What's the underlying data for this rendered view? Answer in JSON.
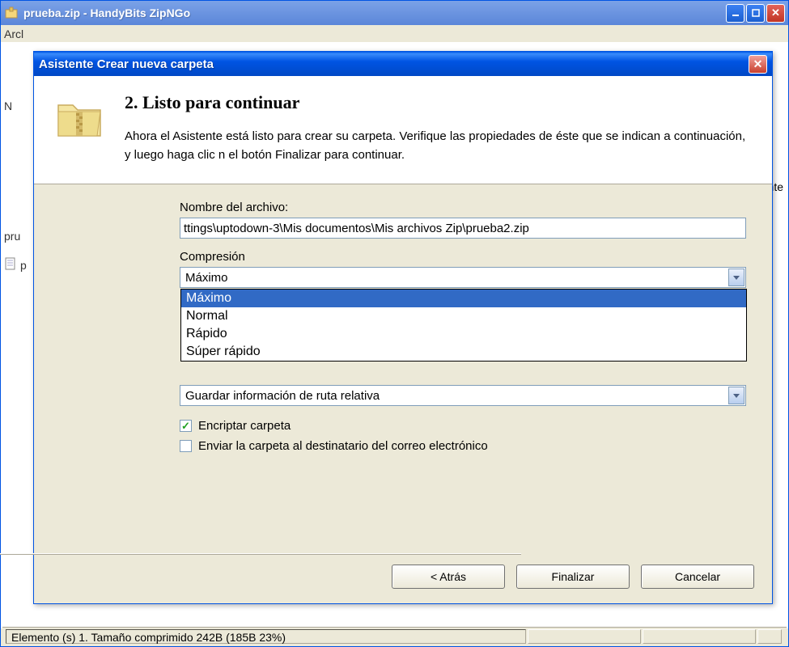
{
  "mainWindow": {
    "title": "prueba.zip - HandyBits ZipNGo",
    "menuFragment": "Arcl",
    "leftLetter1": "N",
    "leftLetter2": "pru",
    "leftFileFragment": "p",
    "rightFragment": "ente"
  },
  "statusbar": {
    "text": "Elemento (s) 1. Tamaño comprimido 242B (185B 23%)"
  },
  "dialog": {
    "title": "Asistente Crear nueva carpeta",
    "heading": "2. Listo para continuar",
    "description": "Ahora el Asistente está listo para crear su carpeta. Verifique las propiedades de éste que se indican a continuación, y luego haga clic n el botón Finalizar para continuar.",
    "fileNameLabel": "Nombre del archivo:",
    "fileNameValue": "ttings\\uptodown-3\\Mis documentos\\Mis archivos Zip\\prueba2.zip",
    "compressionLabel": "Compresión",
    "compressionValue": "Máximo",
    "compressionOptions": [
      "Máximo",
      "Normal",
      "Rápido",
      "Súper rápido"
    ],
    "pathInfoValue": "Guardar información de ruta relativa",
    "encryptLabel": "Encriptar carpeta",
    "emailLabel": "Enviar la carpeta al destinatario del correo electrónico",
    "buttons": {
      "back": "< Atrás",
      "finish": "Finalizar",
      "cancel": "Cancelar"
    }
  }
}
